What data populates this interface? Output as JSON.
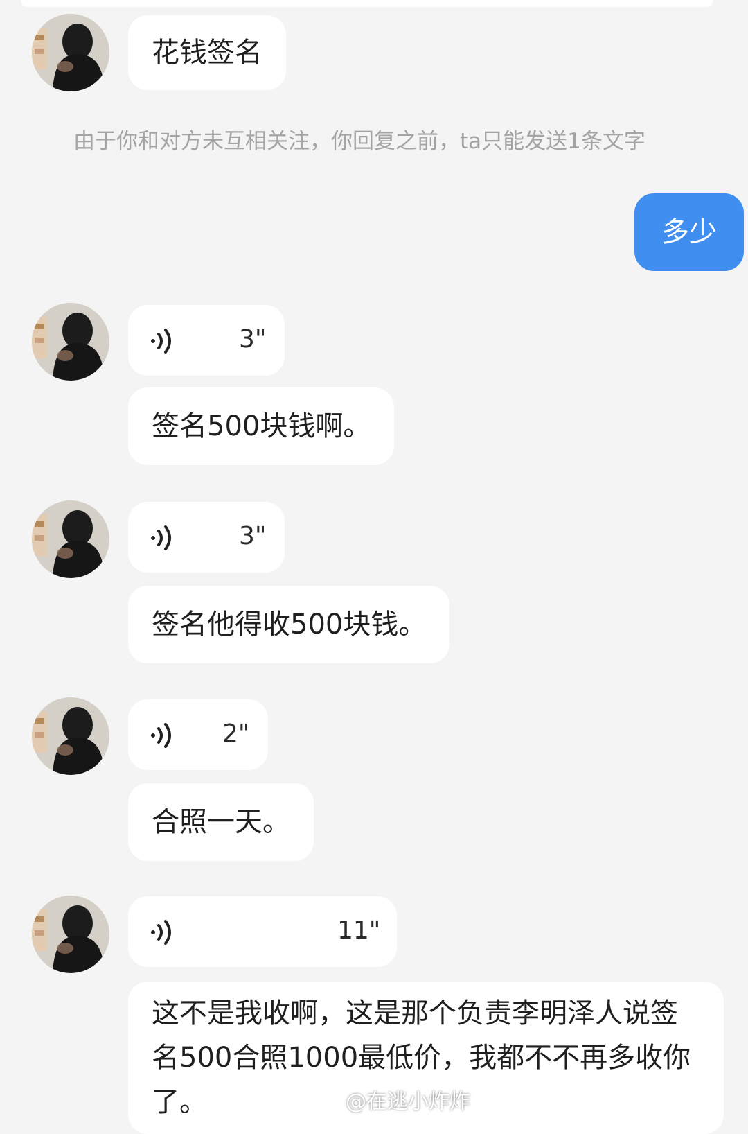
{
  "messages": {
    "m1_text": "花钱签名",
    "notice": "由于你和对方未互相关注，你回复之前，ta只能发送1条文字",
    "outgoing_text": "多少",
    "voice1_duration": "3\"",
    "m2_text": "签名500块钱啊。",
    "voice2_duration": "3\"",
    "m3_text": "签名他得收500块钱。",
    "voice3_duration": "2\"",
    "m4_text": "合照一天。",
    "voice4_duration": "11\"",
    "m5_text": "这不是我收啊，这是那个负责李明泽人说签名500合照1000最低价，我都不不再多收你了。"
  },
  "watermark": {
    "text": "@在逃小炸炸"
  },
  "colors": {
    "background": "#f4f4f4",
    "incoming_bubble": "#ffffff",
    "outgoing_bubble": "#3f8ef0",
    "notice_text": "#a4a4a4"
  },
  "icons": {
    "avatar": "avatar-hooded-figure",
    "voice": "voice-wave-icon",
    "watermark": "weibo-logo-icon"
  }
}
